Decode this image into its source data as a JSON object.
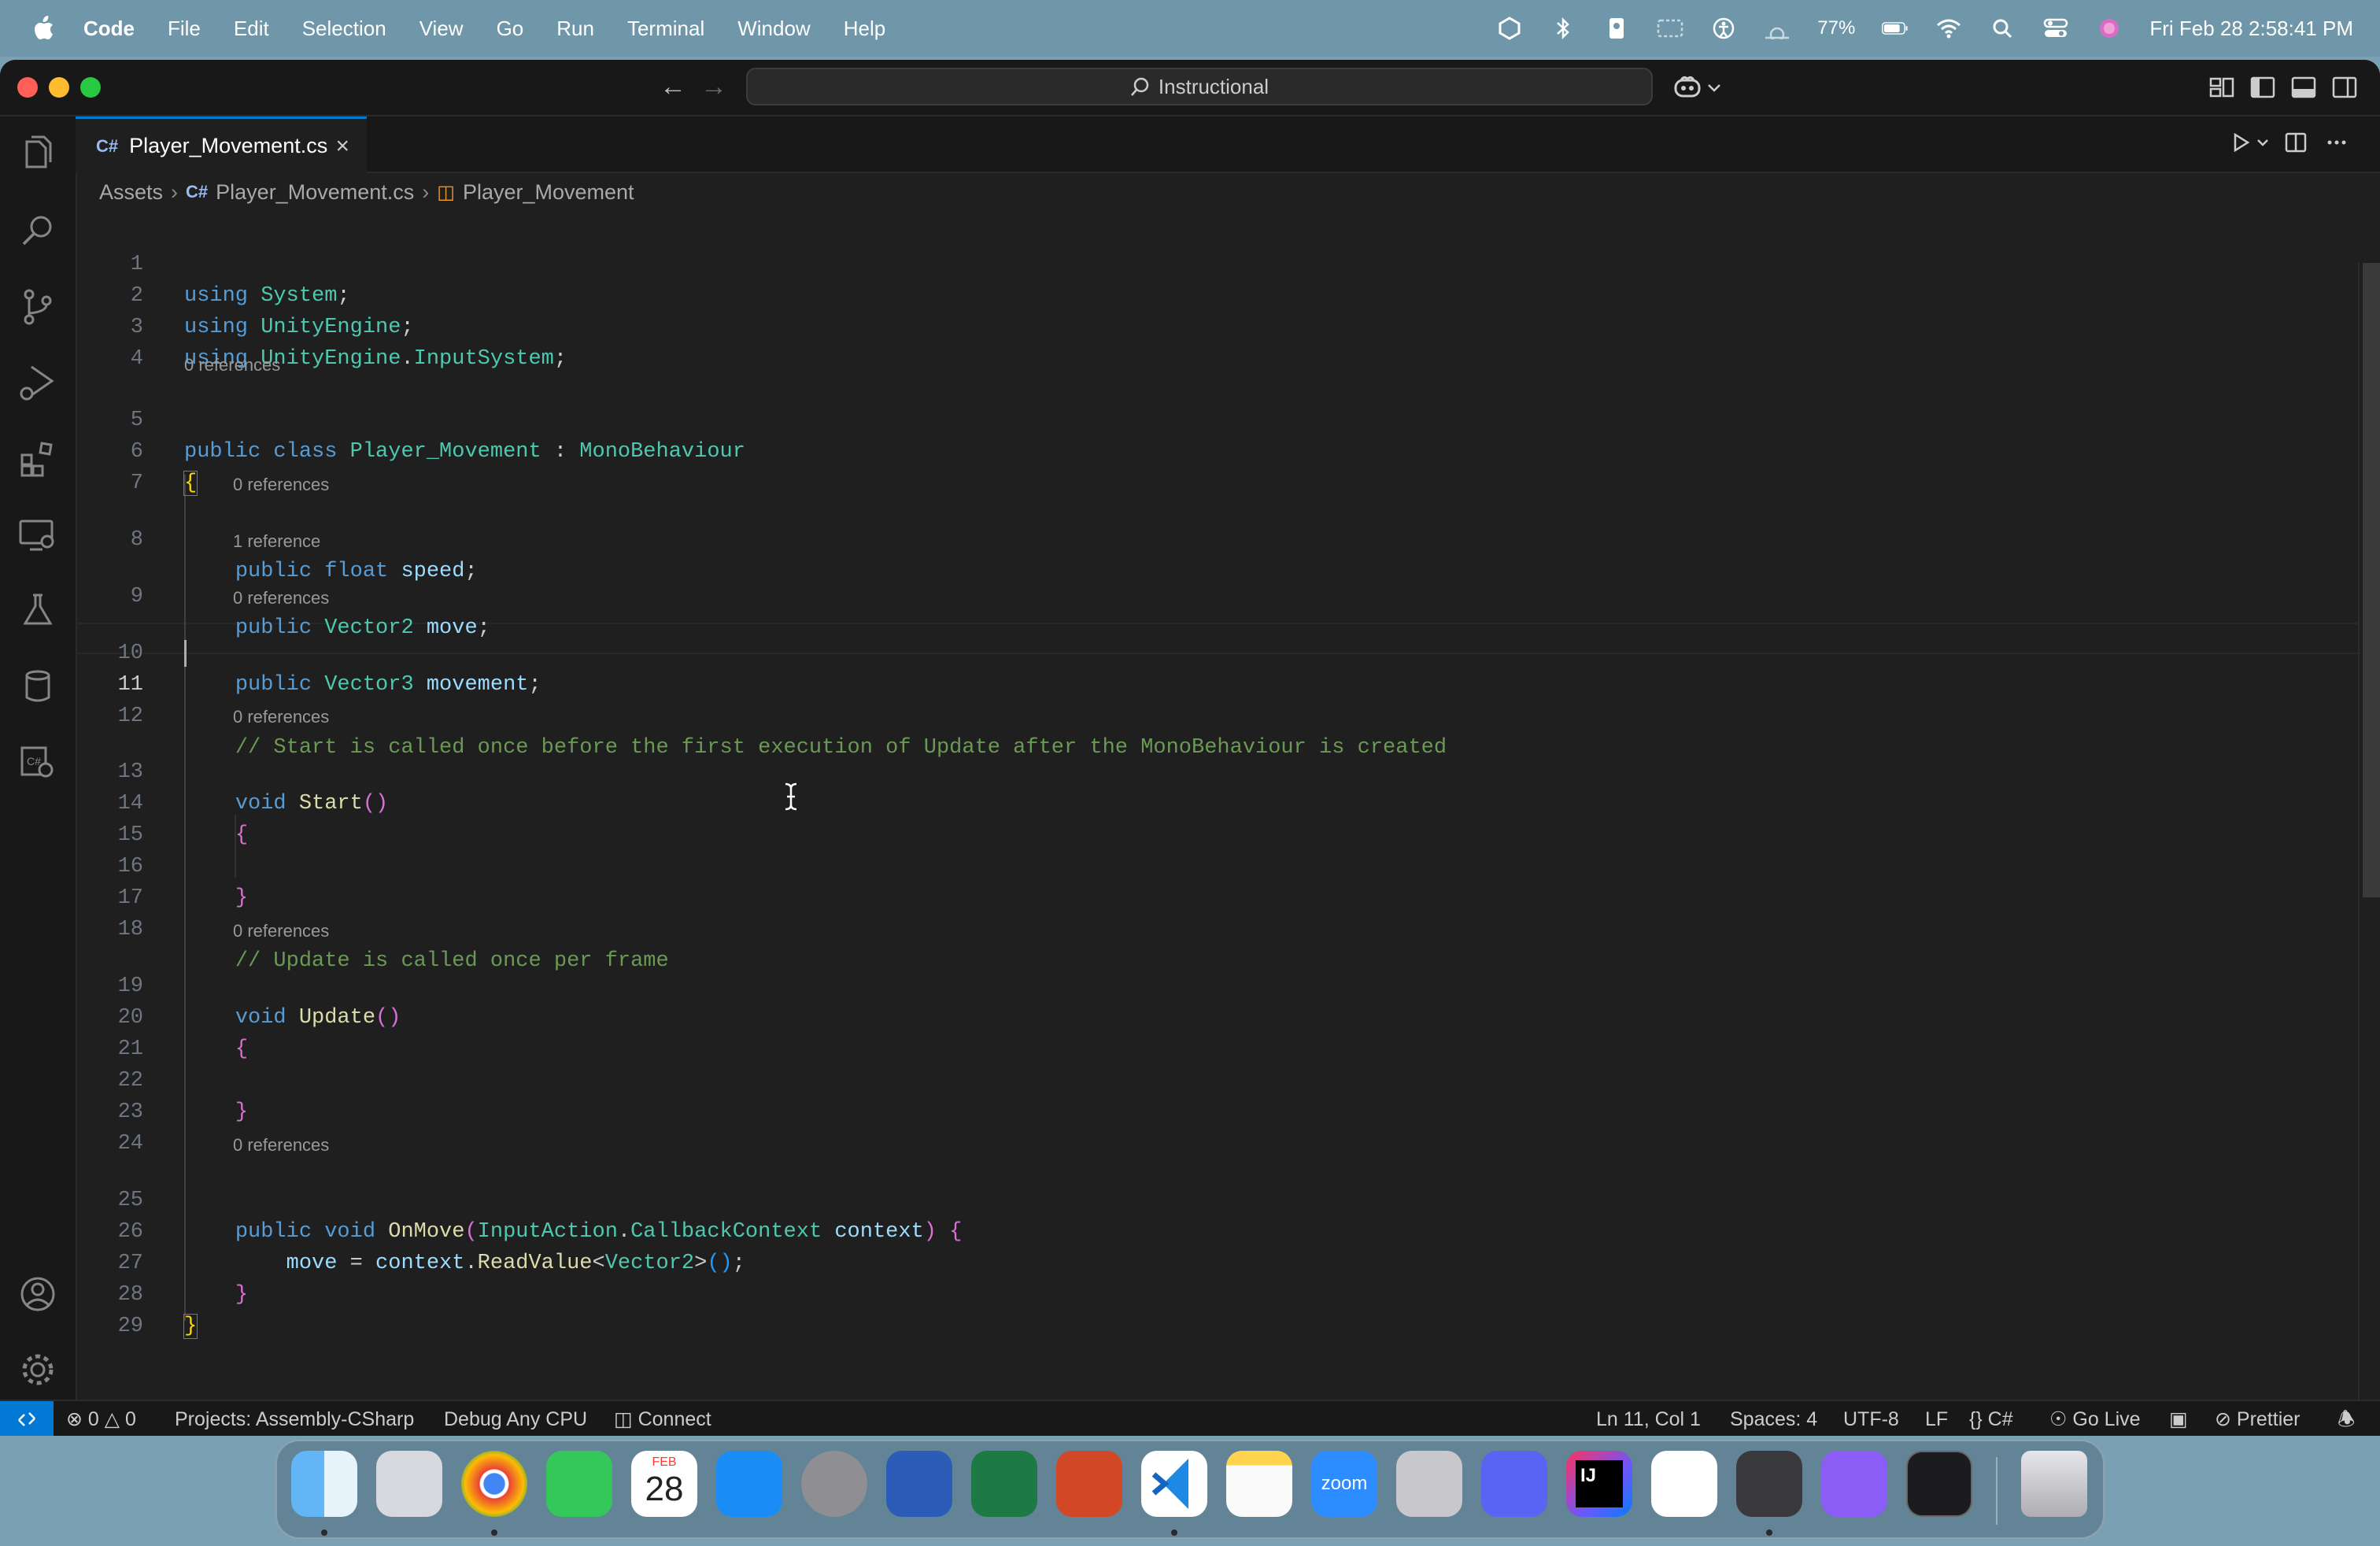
{
  "menubar": {
    "app_name": "Code",
    "items": [
      "File",
      "Edit",
      "Selection",
      "View",
      "Go",
      "Run",
      "Terminal",
      "Window",
      "Help"
    ],
    "battery": "77%",
    "clock": "Fri Feb 28  2:58:41 PM"
  },
  "titlebar": {
    "search_text": "Instructional"
  },
  "tab": {
    "label": "Player_Movement.cs"
  },
  "breadcrumb": {
    "folder": "Assets",
    "file": "Player_Movement.cs",
    "symbol": "Player_Movement"
  },
  "editor": {
    "line_numbers": [
      "1",
      "2",
      "3",
      "4",
      "5",
      "6",
      "7",
      "8",
      "9",
      "10",
      "11",
      "12",
      "13",
      "14",
      "15",
      "16",
      "17",
      "18",
      "19",
      "20",
      "21",
      "22",
      "23",
      "24",
      "25",
      "26",
      "27",
      "28",
      "29"
    ],
    "active_line": "11",
    "code": {
      "l1_kw": "using",
      "l1_ns": "System",
      "l2_kw": "using",
      "l2_ns": "UnityEngine",
      "l3_kw": "using",
      "l3_ns": "UnityEngine",
      "l3_ns2": "InputSystem",
      "l5_public": "public",
      "l5_class": "class",
      "l5_name": "Player_Movement",
      "l5_base": "MonoBehaviour",
      "l8_public": "public",
      "l8_type": "float",
      "l8_var": "speed",
      "l9_public": "public",
      "l9_type": "Vector2",
      "l9_var": "move",
      "l10_public": "public",
      "l10_type": "Vector3",
      "l10_var": "movement",
      "l12_comment": "// Start is called once before the first execution of Update after the MonoBehaviour is created",
      "l13_void": "void",
      "l13_fn": "Start",
      "l18_comment": "// Update is called once per frame",
      "l19_void": "void",
      "l19_fn": "Update",
      "l25_public": "public",
      "l25_void": "void",
      "l25_fn": "OnMove",
      "l25_type1": "InputAction",
      "l25_type2": "CallbackContext",
      "l25_param": "context",
      "l26_var": "move",
      "l26_obj": "context",
      "l26_fn": "ReadValue",
      "l26_type": "Vector2"
    },
    "codelens": {
      "class_refs": "0 references",
      "speed_refs": "0 references",
      "move_refs": "1 reference",
      "movement_refs": "0 references",
      "start_refs": "0 references",
      "update_refs": "0 references",
      "onmove_refs": "0 references"
    }
  },
  "statusbar": {
    "errors": "0",
    "warnings": "0",
    "projects": "Projects: Assembly-CSharp",
    "debug": "Debug Any CPU",
    "connect": "Connect",
    "position": "Ln 11, Col 1",
    "spaces": "Spaces: 4",
    "encoding": "UTF-8",
    "eol": "LF",
    "language": "C#",
    "golive": "Go Live",
    "prettier": "Prettier"
  },
  "dock": {
    "calendar_month": "FEB",
    "calendar_day": "28",
    "zoom_label": "zoom",
    "intellij_label": "IJ"
  },
  "colors": {
    "accent": "#0078d4",
    "keyword": "#569cd6",
    "type": "#4ec9b0",
    "function": "#dcdcaa",
    "variable": "#9cdcfe",
    "comment": "#6a9955"
  }
}
